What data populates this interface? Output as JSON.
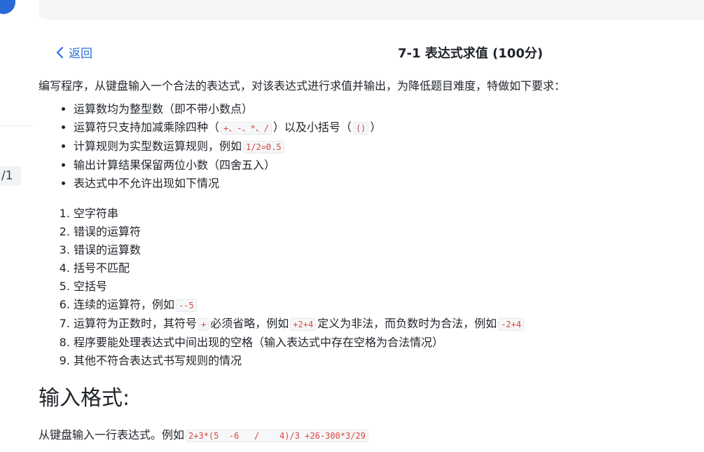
{
  "left_fragment": {
    "badge_text": "/1"
  },
  "header": {
    "back_label": "返回",
    "title": "7-1 表达式求值 (100分)"
  },
  "intro": "编写程序，从键盘输入一个合法的表达式，对该表达式进行求值并输出，为降低题目难度，特做如下要求：",
  "requirements": [
    {
      "text": "运算数均为整型数（即不带小数点）"
    },
    {
      "text_before": "运算符只支持加减乘除四种（",
      "code": "+、-、*、/",
      "text_mid": "）以及小括号（",
      "code2": "()",
      "text_after": "）"
    },
    {
      "text_before": "计算规则为实型数运算规则，例如",
      "code": "1/2=0.5"
    },
    {
      "text": "输出计算结果保留两位小数（四舍五入）"
    },
    {
      "text": "表达式中不允许出现如下情况"
    }
  ],
  "cases": [
    {
      "text": "空字符串"
    },
    {
      "text": "错误的运算符"
    },
    {
      "text": "错误的运算数"
    },
    {
      "text": "括号不匹配"
    },
    {
      "text": "空括号"
    },
    {
      "text_before": "连续的运算符，例如",
      "code": "--5"
    },
    {
      "text_before": "运算符为正数时，其符号",
      "code": "+",
      "text_mid": "必须省略，例如",
      "code2": "+2+4",
      "text_mid2": "定义为非法，而负数时为合法，例如",
      "code3": "-2+4"
    },
    {
      "text": "程序要能处理表达式中间出现的空格（输入表达式中存在空格为合法情况）"
    },
    {
      "text": "其他不符合表达式书写规则的情况"
    }
  ],
  "input_section": {
    "heading": "输入格式:",
    "desc_before": "从键盘输入一行表达式。例如",
    "code": "2+3*(5  -6   /    4)/3 +26-300*3/29"
  },
  "colors": {
    "link": "#2d6fd8",
    "code_text": "#d6463b",
    "code_bg": "#f6f7f9",
    "accent_circle": "#2a6ad8"
  }
}
